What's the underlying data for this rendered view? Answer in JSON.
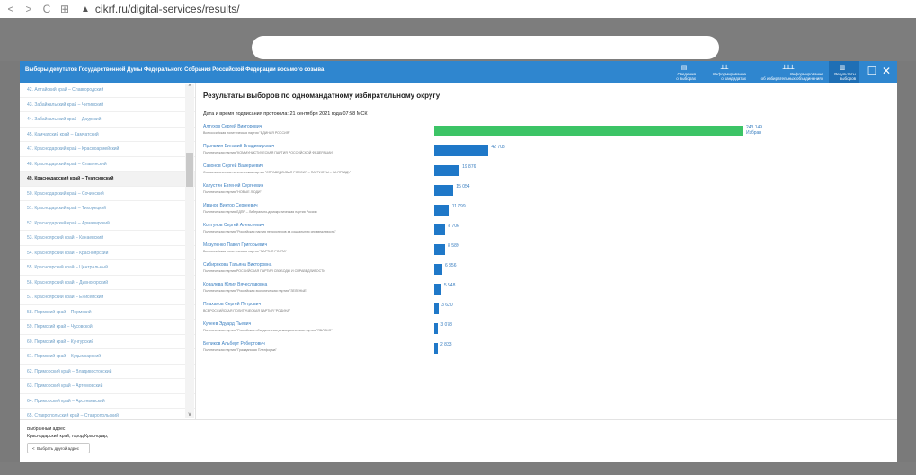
{
  "browser": {
    "back": "<",
    "forward": ">",
    "reload": "C",
    "apps": "⊞",
    "warning": "▲",
    "url": "cikrf.ru/digital-services/results/"
  },
  "modal": {
    "title": "Выборы депутатов Государственной Думы Федерального Собрания Российской Федерации восьмого созыва",
    "tabs": [
      {
        "icon": "▤",
        "label1": "Сведения",
        "label2": "о выборах"
      },
      {
        "icon": "ꓕꓕ",
        "label1": "Информирование",
        "label2": "о кандидатах"
      },
      {
        "icon": "ꓕꓕꓕ",
        "label1": "Информирование",
        "label2": "об избирательных объединениях"
      },
      {
        "icon": "▥",
        "label1": "Результаты",
        "label2": "выборов"
      }
    ],
    "maximize": "☐",
    "close": "✕"
  },
  "sidebar": {
    "items": [
      "42. Алтайский край – Славгородский",
      "43. Забайкальский край – Читинский",
      "44. Забайкальский край – Даурский",
      "45. Камчатский край – Камчатский",
      "47. Краснодарский край – Красноармейский",
      "48. Краснодарский край – Славянский",
      "49. Краснодарский край – Туапсинский",
      "50. Краснодарский край – Сочинский",
      "51. Краснодарский край – Тихорецкий",
      "52. Краснодарский край – Армавирский",
      "53. Красноярский край – Канаевский",
      "54. Красноярский край – Красноярский",
      "55. Красноярский край – Центральный",
      "56. Красноярский край – Дивногорский",
      "57. Красноярский край – Енисейский",
      "58. Пермский край – Пермский",
      "59. Пермский край – Чусовской",
      "60. Пермский край – Кунгурский",
      "61. Пермский край – Кудымкарский",
      "62. Приморский край – Владивостокский",
      "63. Приморский край – Артемовский",
      "64. Приморский край – Арсеньевский",
      "65. Ставропольский край – Ставропольский"
    ],
    "active_index": 6,
    "scroll_up": "^",
    "scroll_down": "v"
  },
  "main": {
    "heading": "Результаты выборов по одномандатному избирательному округу",
    "protocol": "Дата и время подписания протокола: 21 сентября 2021 года 07:58 МСК",
    "winner_label": "Избран"
  },
  "chart_data": {
    "type": "bar",
    "orientation": "horizontal",
    "categories": [
      "Алтухов Сергей Викторович",
      "Пронькин Виталий Владимирович",
      "Сазонов Сергей Валерьевич",
      "Капустин Евгений Сергеевич",
      "Иванов Виктор Сергеевич",
      "Колтунов Сергей Алексеевич",
      "Мазуленко Павел Григорьевич",
      "Сибирякова Татьяна Викторовна",
      "Ковалева Юлия Вячеславовна",
      "Плаханов Сергей Петрович",
      "Кучеев Эдуард Пьевич",
      "Беликов Альберт Робертович"
    ],
    "parties": [
      "Всероссийская политическая партия \"ЕДИНАЯ РОССИЯ\"",
      "Политическая партия \"КОММУНИСТИЧЕСКАЯ ПАРТИЯ РОССИЙСКОЙ ФЕДЕРАЦИИ\"",
      "Социалистическая политическая партия \"СПРАВЕДЛИВАЯ РОССИЯ – ПАТРИОТЫ – ЗА ПРАВДУ\"",
      "Политическая партия \"НОВЫЕ ЛЮДИ\"",
      "Политическая партия ЛДПР – Либерально-демократическая партия России",
      "Политическая партия \"Российская партия пенсионеров за социальную справедливость\"",
      "Всероссийская политическая партия \"ПАРТИЯ РОСТА\"",
      "Политическая партия РОССИЙСКАЯ ПАРТИЯ СВОБОДЫ И СПРАВЕДЛИВОСТИ",
      "Политическая партия \"Российская экологическая партия \"ЗЕЛЕНЫЕ\"",
      "ВСЕРОССИЙСКАЯ ПОЛИТИЧЕСКАЯ ПАРТИЯ \"РОДИНА\"",
      "Политическая партия \"Российская объединенная демократическая партия \"ЯБЛОКО\"",
      "Политическая партия \"Гражданская Платформа\""
    ],
    "values": [
      243149,
      42708,
      19876,
      15054,
      11799,
      8706,
      8589,
      6356,
      5548,
      3620,
      3078,
      2833
    ],
    "labels": [
      "243 149",
      "42 708",
      "19 876",
      "15 054",
      "11 799",
      "8 706",
      "8 589",
      "6 356",
      "5 548",
      "3 620",
      "3 078",
      "2 833"
    ],
    "winner_index": 0,
    "colors": {
      "winner": "#3cc466",
      "other": "#1f78c8"
    }
  },
  "footer": {
    "selected_label": "Выбранный адрес",
    "address": "Краснодарский край, город Краснодар,",
    "change_button": "Выбрать другой адрес",
    "back_icon": "<"
  },
  "colors": {
    "accent": "#2f86cf",
    "accent_dark": "#1f6fb5",
    "link": "#6fa0c8"
  }
}
